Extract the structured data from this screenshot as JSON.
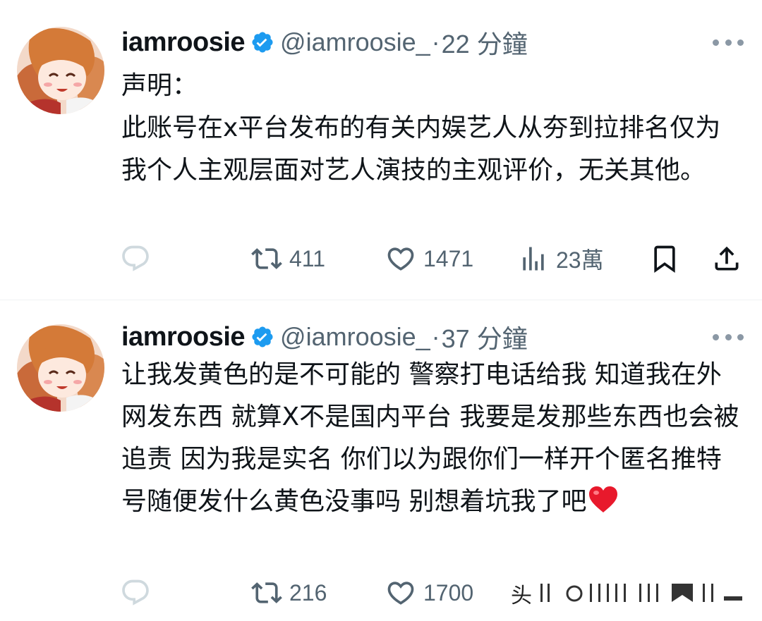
{
  "colors": {
    "text_primary": "#0f1419",
    "text_secondary": "#536471",
    "verified_blue": "#1d9bf0",
    "divider": "#eff3f4",
    "heart_red": "#e8192c"
  },
  "tweets": [
    {
      "display_name": "iamroosie",
      "verified_icon": "verified-badge-icon",
      "handle": "@iamroosie_",
      "dot": "·",
      "time": "22 分鐘",
      "text": "声明：\n此账号在x平台发布的有关内娱艺人从夯到拉排名仅为我个人主观层面对艺人演技的主观评价，无关其他。",
      "text_emoji": "",
      "actions": {
        "reply_count": "",
        "retweet_count": "411",
        "like_count": "1471",
        "views_count": "23萬"
      }
    },
    {
      "display_name": "iamroosie",
      "verified_icon": "verified-badge-icon",
      "handle": "@iamroosie_",
      "dot": "·",
      "time": "37 分鐘",
      "text": "让我发黄色的是不可能的 警察打电话给我 知道我在外网发东西 就算X不是国内平台 我要是发那些东西也会被追责 因为我是实名 你们以为跟你们一样开个匿名推特号随便发什么黄色没事吗 别想着坑我了吧",
      "text_emoji": "heart-emoji",
      "actions": {
        "reply_count": "",
        "retweet_count": "216",
        "like_count": "1700",
        "views_count": ""
      }
    }
  ],
  "watermark": {
    "text": "头"
  }
}
